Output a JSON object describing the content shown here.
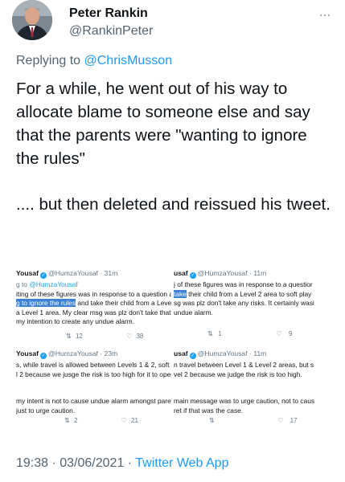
{
  "author": {
    "name": "Peter Rankin",
    "handle": "@RankinPeter",
    "more_icon": "more-horizontal-icon"
  },
  "reply": {
    "prefix": "Replying to ",
    "to": "@ChrisMusson"
  },
  "tweet": {
    "paragraph1": "For a while, he went out of his way to allocate blame to someone else and say that the parents were \"wanting to ignore the rules\"",
    "paragraph2": ".... but then deleted and reissued his tweet."
  },
  "embedded": {
    "top_left": {
      "name": "Yousaf",
      "handle": "@HumzaYousaf · 31m",
      "replying_prefix": "g to ",
      "replying_to": "@HumzaYousaf",
      "line1": "iting of these figures was in response to a question at",
      "line2_highlight": "g to ignore the rules",
      "line2_rest": " and take their child from a Level",
      "line3": "a Level 1 area. My clear msg was plz don't take that ri",
      "line4": "my intention to create any undue alarm.",
      "retweets": "12",
      "likes": "38"
    },
    "top_right": {
      "name": "usaf",
      "handle": "@HumzaYousaf · 11m",
      "line1": "j of these figures was in response to a questior",
      "line2_highlight": "take",
      "line2_rest": " their child from a Level 2 area to soft play",
      "line3": "sg was plz don't take any risks. It certainly wasi",
      "line4": "undue alarm.",
      "retweets": "1",
      "likes": "9"
    },
    "bottom_left": {
      "name": "Yousaf",
      "handle": "@HumzaYousaf · 23m",
      "line1": "s, while travel is allowed between Levels 1 & 2, soft pl",
      "line2": "l 2 because we jusge the risk is too high for it to oper",
      "line3": "my intent is not to cause undue alarm amongst paren",
      "line4": " just to urge caution.",
      "retweets": "2",
      "likes": "21"
    },
    "bottom_right": {
      "name": "usaf",
      "handle": "@HumzaYousaf · 11m",
      "line1": "n travel between Level 1 & Level 2 areas, but s",
      "line2": "vel 2 because we judge the risk is too high.",
      "line3": "main message was to urge caution, not to caus",
      "line4": "ret if that was the case.",
      "retweets": "",
      "likes": "17"
    }
  },
  "meta": {
    "time": "19:38 · 03/06/2021 · ",
    "source": "Twitter Web App"
  }
}
